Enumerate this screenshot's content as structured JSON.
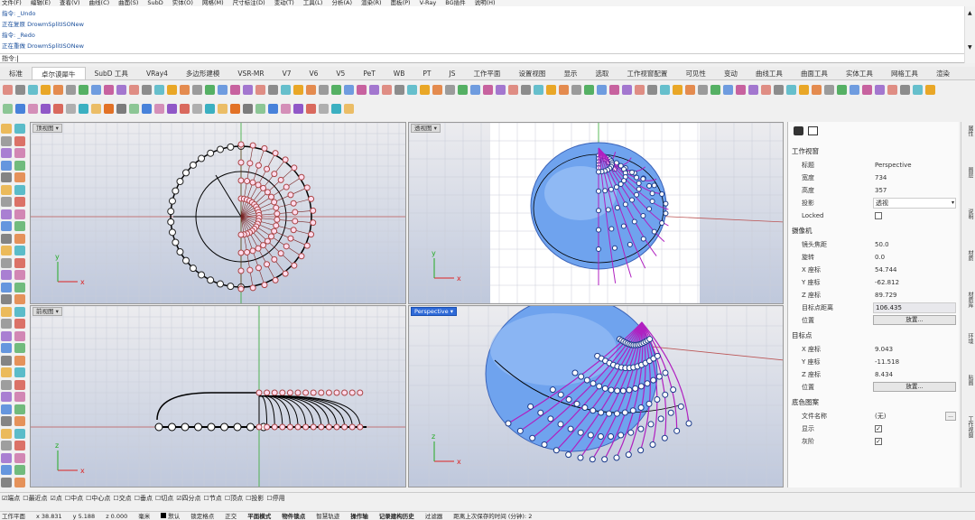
{
  "menu": [
    "文件(F)",
    "编辑(E)",
    "查看(V)",
    "曲线(C)",
    "曲面(S)",
    "SubD",
    "实体(O)",
    "网格(M)",
    "尺寸标注(D)",
    "变动(T)",
    "工具(L)",
    "分析(A)",
    "渲染(R)",
    "面板(P)",
    "V-Ray",
    "BG插件",
    "说明(H)"
  ],
  "command_history": [
    "指令: _Undo",
    "正在复原 DrowmSplitISONew",
    "指令: _Redo",
    "正在重做 DrowmSplitISONew"
  ],
  "command_prompt": "指令:",
  "tabs": [
    "标准",
    "卓尔谟犀牛",
    "SubD 工具",
    "VRay4",
    "多边形建模",
    "VSR-MR",
    "V7",
    "V6",
    "V5",
    "PeT",
    "WB",
    "PT",
    "JS",
    "工作平面",
    "设置视图",
    "显示",
    "选取",
    "工作视窗配置",
    "可见性",
    "变动",
    "曲线工具",
    "曲面工具",
    "实体工具",
    "网格工具",
    "渲染"
  ],
  "active_tab": "卓尔谟犀牛",
  "viewports": {
    "top": "顶视图",
    "perspective_top": "透视图",
    "front": "前视图",
    "perspective": "Perspective"
  },
  "axis": {
    "x": "x",
    "y": "y",
    "z": "z"
  },
  "panel": {
    "section_view": "工作视窗",
    "title_label": "标题",
    "title_value": "Perspective",
    "width_label": "宽度",
    "width_value": "734",
    "height_label": "高度",
    "height_value": "357",
    "projection_label": "投影",
    "projection_value": "透视",
    "locked_label": "Locked",
    "section_camera": "摄像机",
    "focal_label": "镜头焦距",
    "focal_value": "50.0",
    "rotation_label": "旋转",
    "rotation_value": "0.0",
    "camx_label": "X 座标",
    "camx_value": "54.744",
    "camy_label": "Y 座标",
    "camy_value": "-62.812",
    "camz_label": "Z 座标",
    "camz_value": "89.729",
    "dist_label": "目标点距离",
    "dist_value": "106.435",
    "pos_label": "位置",
    "place_button": "放置...",
    "section_target": "目标点",
    "tx_label": "X 座标",
    "tx_value": "9.043",
    "ty_label": "Y 座标",
    "ty_value": "-11.518",
    "tz_label": "Z 座标",
    "tz_value": "8.434",
    "tpos_label": "位置",
    "tplace_button": "放置...",
    "section_bg": "底色图案",
    "file_label": "文件名称",
    "file_value": "(无)",
    "show_label": "显示",
    "gray_label": "灰阶"
  },
  "side_tabs": [
    "属性",
    "图层",
    "说明",
    "材质",
    "材质库",
    "环境",
    "贴图",
    "工作视窗"
  ],
  "osnaps": [
    {
      "label": "端点",
      "checked": true
    },
    {
      "label": "最近点",
      "checked": false
    },
    {
      "label": "点",
      "checked": true
    },
    {
      "label": "中点",
      "checked": false
    },
    {
      "label": "中心点",
      "checked": false
    },
    {
      "label": "交点",
      "checked": false
    },
    {
      "label": "垂点",
      "checked": false
    },
    {
      "label": "切点",
      "checked": false
    },
    {
      "label": "四分点",
      "checked": true
    },
    {
      "label": "节点",
      "checked": false
    },
    {
      "label": "顶点",
      "checked": false
    },
    {
      "label": "投影",
      "checked": false
    },
    {
      "label": "停用",
      "checked": false
    }
  ],
  "status": {
    "cplane": "工作平面",
    "x": "x 38.831",
    "y": "y 5.188",
    "z": "z 0.000",
    "units": "毫米",
    "layer": "默认",
    "grid_snap": "锁定格点",
    "ortho": "正交",
    "planar": "平面模式",
    "osnap": "物件锁点",
    "smarttrack": "智慧轨迹",
    "gumball": "操作轴",
    "history": "记录建构历史",
    "filter": "过滤器",
    "autosave": "距离上次保存的时间 (分钟): 2"
  }
}
